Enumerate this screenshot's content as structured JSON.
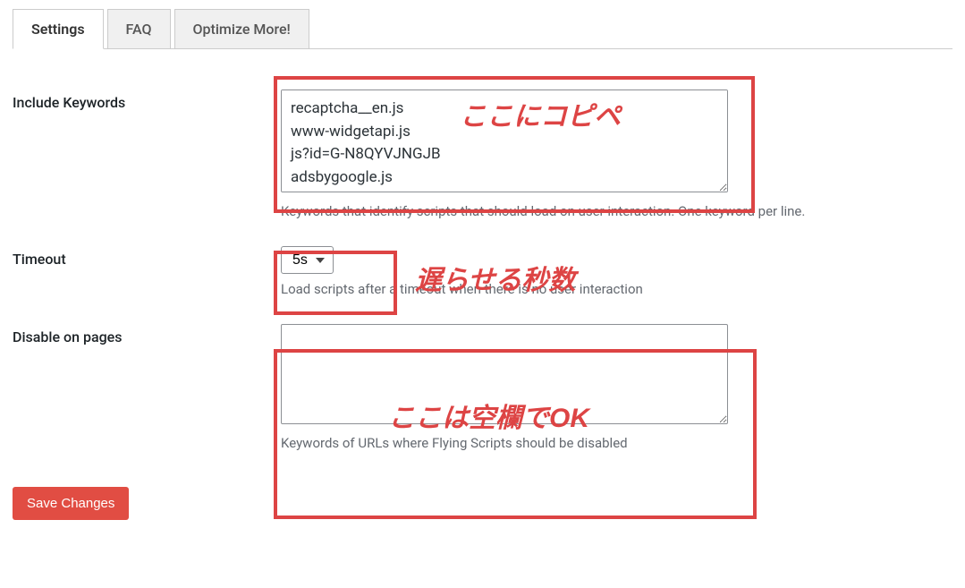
{
  "tabs": {
    "settings": "Settings",
    "faq": "FAQ",
    "optimize": "Optimize More!"
  },
  "fields": {
    "include_keywords": {
      "label": "Include Keywords",
      "value": "recaptcha__en.js\nwww-widgetapi.js\njs?id=G-N8QYVJNGJB\nadsbygoogle.js",
      "description": "Keywords that identify scripts that should load on user interaction. One keyword per line."
    },
    "timeout": {
      "label": "Timeout",
      "value": "5s",
      "description": "Load scripts after a timeout when there is no user interaction"
    },
    "disable_on_pages": {
      "label": "Disable on pages",
      "value": "",
      "description": "Keywords of URLs where Flying Scripts should be disabled"
    }
  },
  "buttons": {
    "save": "Save Changes"
  },
  "annotations": {
    "a1": "ここにコピペ",
    "a2": "遅らせる秒数",
    "a3": "ここは空欄でOK"
  }
}
